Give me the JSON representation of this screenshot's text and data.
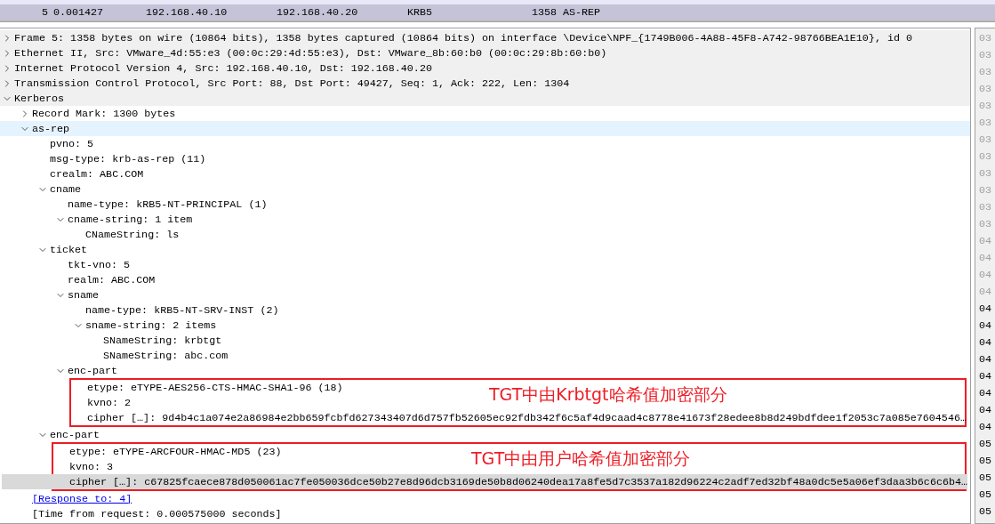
{
  "packet_list": {
    "rows": [
      {
        "no": "5",
        "time": "0.001427",
        "source": "192.168.40.10",
        "destination": "192.168.40.20",
        "protocol": "KRB5",
        "length": "1358",
        "info": "AS-REP",
        "selected": true
      }
    ]
  },
  "details": [
    {
      "text": "Frame 5: 1358 bytes on wire (10864 bits), 1358 bytes captured (10864 bits) on interface \\Device\\NPF_{1749B006-4A88-45F8-A742-98766BEA1E10}, id 0",
      "expanded": false
    },
    {
      "text": "Ethernet II, Src: VMware_4d:55:e3 (00:0c:29:4d:55:e3), Dst: VMware_8b:60:b0 (00:0c:29:8b:60:b0)",
      "expanded": false
    },
    {
      "text": "Internet Protocol Version 4, Src: 192.168.40.10, Dst: 192.168.40.20",
      "expanded": false
    },
    {
      "text": "Transmission Control Protocol, Src Port: 88, Dst Port: 49427, Seq: 1, Ack: 222, Len: 1304",
      "expanded": false
    },
    {
      "text": "Kerberos",
      "expanded": true,
      "children": [
        {
          "text": "Record Mark: 1300 bytes",
          "expanded": false
        },
        {
          "text": "as-rep",
          "expanded": true,
          "hovered": true,
          "children": [
            {
              "text": "pvno: 5"
            },
            {
              "text": "msg-type: krb-as-rep (11)"
            },
            {
              "text": "crealm: ABC.COM"
            },
            {
              "text": "cname",
              "expanded": true,
              "children": [
                {
                  "text": "name-type: kRB5-NT-PRINCIPAL (1)"
                },
                {
                  "text": "cname-string: 1 item",
                  "expanded": true,
                  "children": [
                    {
                      "text": "CNameString: ls"
                    }
                  ]
                }
              ]
            },
            {
              "text": "ticket",
              "expanded": true,
              "children": [
                {
                  "text": "tkt-vno: 5"
                },
                {
                  "text": "realm: ABC.COM"
                },
                {
                  "text": "sname",
                  "expanded": true,
                  "children": [
                    {
                      "text": "name-type: kRB5-NT-SRV-INST (2)"
                    },
                    {
                      "text": "sname-string: 2 items",
                      "expanded": true,
                      "children": [
                        {
                          "text": "SNameString: krbtgt"
                        },
                        {
                          "text": "SNameString: abc.com"
                        }
                      ]
                    }
                  ]
                },
                {
                  "text": "enc-part",
                  "expanded": true,
                  "annotation": "TGT中由Krbtgt哈希值加密部分",
                  "children": [
                    {
                      "text": "etype: eTYPE-AES256-CTS-HMAC-SHA1-96 (18)"
                    },
                    {
                      "text": "kvno: 2"
                    },
                    {
                      "text": "cipher […]: 9d4b4c1a074e2a86984e2bb659fcbfd627343407d6d757fb52605ec92fdb342f6c5af4d9caad4c8778e41673f28edee8b8d249bdfdee1f2053c7a085e7604546…"
                    }
                  ]
                }
              ]
            },
            {
              "text": "enc-part",
              "expanded": true,
              "annotation": "TGT中由用户哈希值加密部分",
              "children": [
                {
                  "text": "etype: eTYPE-ARCFOUR-HMAC-MD5 (23)"
                },
                {
                  "text": "kvno: 3"
                },
                {
                  "text": "cipher […]: c67825fcaece878d050061ac7fe050036dce50b27e8d96dcb3169de50b8d06240dea17a8fe5d7c3537a182d96224c2adf7ed32bf48a0dc5e5a06ef3daa3b6c6c6b4…",
                  "selected": true
                }
              ]
            }
          ]
        },
        {
          "text": "[Response to: 4]",
          "kind": "link"
        },
        {
          "text": "[Time from request: 0.000575000 seconds]"
        }
      ]
    }
  ],
  "bytes_offsets": [
    {
      "text": "03",
      "dim": true
    },
    {
      "text": "03",
      "dim": true
    },
    {
      "text": "03",
      "dim": true
    },
    {
      "text": "03",
      "dim": true
    },
    {
      "text": "03",
      "dim": true
    },
    {
      "text": "03",
      "dim": true
    },
    {
      "text": "03",
      "dim": true
    },
    {
      "text": "03",
      "dim": true
    },
    {
      "text": "03",
      "dim": true
    },
    {
      "text": "03",
      "dim": true
    },
    {
      "text": "03",
      "dim": true
    },
    {
      "text": "03",
      "dim": true
    },
    {
      "text": "04",
      "dim": true
    },
    {
      "text": "04",
      "dim": true
    },
    {
      "text": "04",
      "dim": true
    },
    {
      "text": "04",
      "dim": true
    },
    {
      "text": "04",
      "dim": false
    },
    {
      "text": "04",
      "dim": false
    },
    {
      "text": "04",
      "dim": false
    },
    {
      "text": "04",
      "dim": false
    },
    {
      "text": "04",
      "dim": false
    },
    {
      "text": "04",
      "dim": false
    },
    {
      "text": "04",
      "dim": false
    },
    {
      "text": "04",
      "dim": false
    },
    {
      "text": "05",
      "dim": false
    },
    {
      "text": "05",
      "dim": false
    },
    {
      "text": "05",
      "dim": false
    },
    {
      "text": "05",
      "dim": false
    },
    {
      "text": "05",
      "dim": false
    }
  ]
}
